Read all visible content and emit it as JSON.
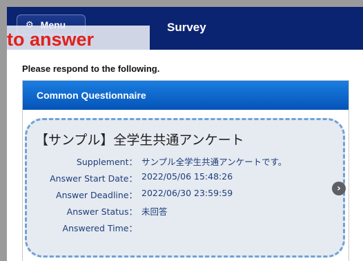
{
  "header": {
    "menu_label": "Menu",
    "title": "Survey",
    "overlay_text": "to answer"
  },
  "instruction": "Please respond to the following.",
  "section": {
    "title": "Common Questionnaire"
  },
  "card": {
    "title": "【サンプル】全学生共通アンケート",
    "fields": [
      {
        "label": "Supplement：",
        "value": "サンプル全学生共通アンケートです。"
      },
      {
        "label": "Answer Start Date：",
        "value": "2022/05/06 15:48:26"
      },
      {
        "label": "Answer Deadline：",
        "value": "2022/06/30 23:59:59"
      },
      {
        "label": "Answer Status：",
        "value": "未回答"
      },
      {
        "label": "Answered Time：",
        "value": ""
      }
    ]
  },
  "colors": {
    "header_bg": "#0a2472",
    "section_header": "#0b63c8",
    "card_bg": "#e6eaf1",
    "card_border": "#6fa1d6",
    "overlay_text": "#e0211c"
  },
  "icons": {
    "menu": "gear-icon",
    "open": "chevron-right-icon"
  }
}
